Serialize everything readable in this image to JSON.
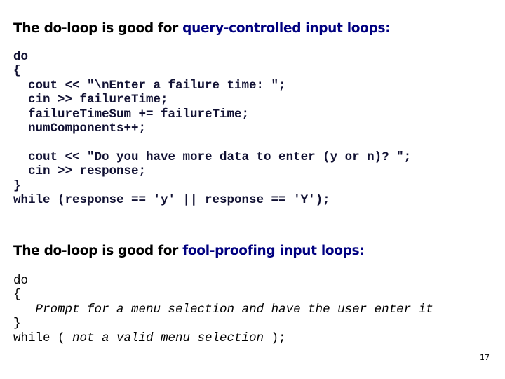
{
  "section1": {
    "heading_prefix": "The do-loop is good for ",
    "heading_highlight": "query-controlled input loops:",
    "code_lines": [
      "do",
      "{",
      "  cout << \"\\nEnter a failure time: \";",
      "  cin >> failureTime;",
      "  failureTimeSum += failureTime;",
      "  numComponents++;",
      "",
      "  cout << \"Do you have more data to enter (y or n)? \";",
      "  cin >> response;",
      "}",
      "while (response == 'y' || response == 'Y');"
    ]
  },
  "section2": {
    "heading_prefix": "The do-loop is good for ",
    "heading_highlight": "fool-proofing input loops:",
    "code": {
      "line1": "do",
      "line2": "{",
      "line3_indent": "   ",
      "line3_italic": "Prompt for a menu selection and have the user enter it",
      "line4": "}",
      "line5_prefix": "while ( ",
      "line5_italic": "not a valid menu selection",
      "line5_suffix": " );"
    }
  },
  "page_number": "17",
  "colors": {
    "heading": "#000000",
    "highlight": "#000080"
  }
}
